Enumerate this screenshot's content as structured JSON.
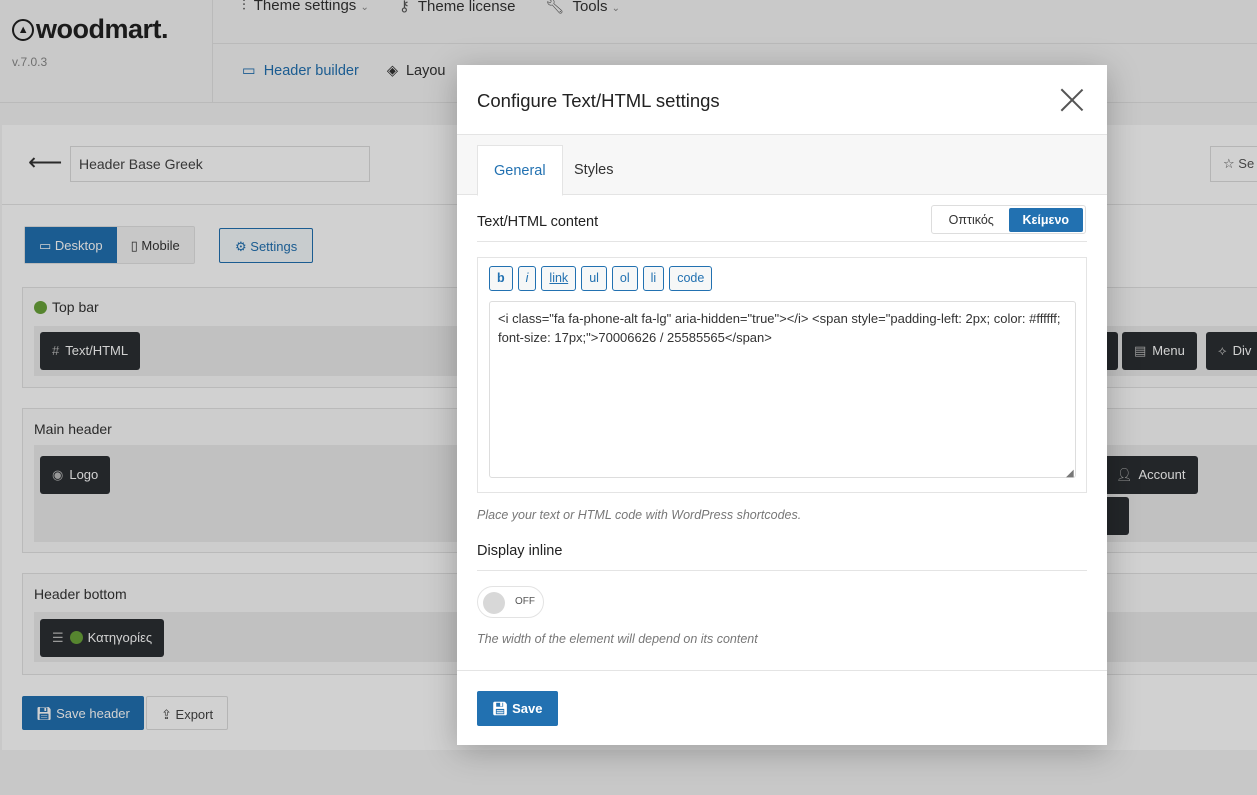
{
  "brand": {
    "name": "woodmart.",
    "version": "v.7.0.3"
  },
  "top_menu": [
    {
      "label": "Theme settings",
      "icon": "sliders-icon"
    },
    {
      "label": "Theme license",
      "icon": "key-icon"
    },
    {
      "label": "Tools",
      "icon": "wrench-icon"
    }
  ],
  "sub_menu": {
    "header_builder": "Header builder",
    "layouts": "Layou"
  },
  "builder": {
    "header_name": "Header Base Greek",
    "star_button": "Se",
    "view_tabs": {
      "desktop": "Desktop",
      "mobile": "Mobile"
    },
    "settings_label": "Settings",
    "regions": {
      "top_bar": {
        "title": "Top bar",
        "chips": {
          "text_html": "Text/HTML",
          "menu": "Menu",
          "divider": "Div"
        }
      },
      "main_header": {
        "title": "Main header",
        "chips": {
          "logo": "Logo",
          "account": "Account"
        }
      },
      "header_bottom": {
        "title": "Header bottom",
        "chips": {
          "categories": "Κατηγορίες"
        }
      }
    },
    "save_header": "Save header",
    "export": "Export"
  },
  "modal": {
    "title": "Configure Text/HTML settings",
    "tabs": [
      "General",
      "Styles"
    ],
    "content_title": "Text/HTML content",
    "mode": {
      "visual": "Οπτικός",
      "text": "Κείμενο"
    },
    "quicktags": [
      "b",
      "i",
      "link",
      "ul",
      "ol",
      "li",
      "code"
    ],
    "content_value": "<i class=\"fa fa-phone-alt fa-lg\" aria-hidden=\"true\"></i> <span style=\"padding-left: 2px; color: #ffffff; font-size: 17px;\">70006626 / 25585565</span>",
    "content_hint": "Place your text or HTML code with WordPress shortcodes.",
    "display_inline_title": "Display inline",
    "toggle_state": "OFF",
    "display_inline_hint": "The width of the element will depend on its content",
    "save": "Save"
  },
  "colors": {
    "accent": "#2271b1",
    "chip_dark": "#2b2f33",
    "status_green": "#6aa33a"
  }
}
